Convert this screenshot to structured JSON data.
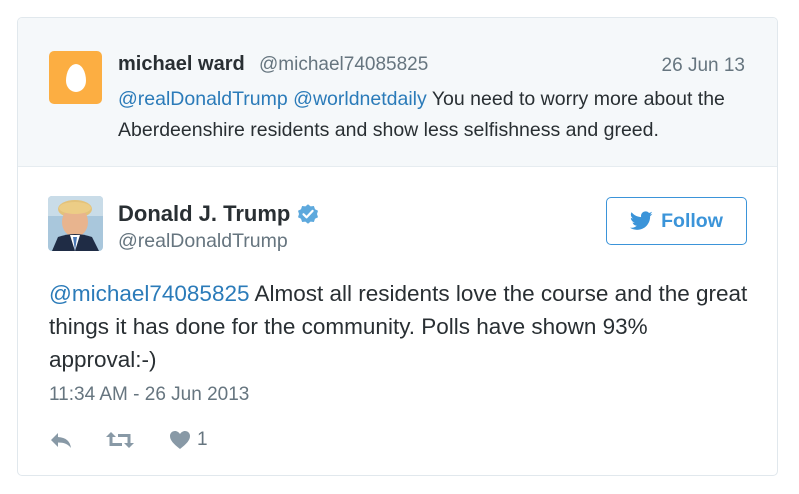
{
  "parent_tweet": {
    "author_name": "michael ward",
    "author_handle": "@michael74085825",
    "date": "26 Jun 13",
    "mention_1": "@realDonaldTrump",
    "mention_2": "@worldnetdaily",
    "text": "You need to worry more about the Aberdeenshire residents and show less selfishness and greed.",
    "avatar_color": "#fcae42",
    "avatar_icon": "egg-icon"
  },
  "tweet": {
    "author_name": "Donald J. Trump",
    "author_handle": "@realDonaldTrump",
    "verified_icon": "verified-badge-icon",
    "follow_label": "Follow",
    "mention": "@michael74085825",
    "text": "Almost all residents love the course and the great things it has done for the community. Polls have shown 93% approval:-)",
    "timestamp": "11:34 AM - 26 Jun 2013",
    "likes_count": "1"
  },
  "colors": {
    "link": "#2b7bb9",
    "accent": "#3b94d9",
    "muted": "#66757f",
    "parent_bg": "#f5f8fa"
  }
}
